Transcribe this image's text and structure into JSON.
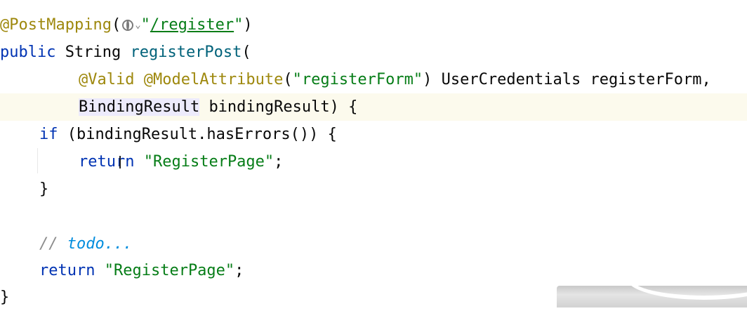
{
  "code": {
    "line1": {
      "annotation": "@PostMapping",
      "open_paren": "(",
      "quote_open": "\"",
      "url": "/register",
      "quote_close": "\"",
      "close_paren": ")"
    },
    "line2": {
      "modifier": "public",
      "type": "String",
      "method": "registerPost",
      "paren": "("
    },
    "line3": {
      "ann_valid": "@Valid",
      "ann_model": "@ModelAttribute",
      "open": "(",
      "arg": "\"registerForm\"",
      "close": ")",
      "param_type": "UserCredentials",
      "param_name": "registerForm,"
    },
    "line4": {
      "param_type": "BindingResult",
      "param_rest": "bindingResult) {"
    },
    "line5": {
      "kw": "if",
      "rest": "(bindingResult.hasErrors()) {"
    },
    "line6": {
      "kw": "return",
      "str": "\"RegisterPage\"",
      "semi": ";"
    },
    "line7": {
      "brace": "}"
    },
    "line9": {
      "slashes": "//",
      "todo": "todo..."
    },
    "line10": {
      "kw": "return",
      "str": "\"RegisterPage\"",
      "semi": ";"
    },
    "line11": {
      "brace": "}"
    }
  },
  "icons": {
    "url_inlay": "globe-icon",
    "inlay_dropdown": "chevron-down-icon",
    "mouse_cursor": "text-cursor-icon"
  },
  "colors": {
    "annotation": "#9e880d",
    "keyword": "#0033b3",
    "string": "#067d17",
    "method": "#00627a",
    "todo": "#008dde",
    "caret_line": "#fcfaed"
  }
}
